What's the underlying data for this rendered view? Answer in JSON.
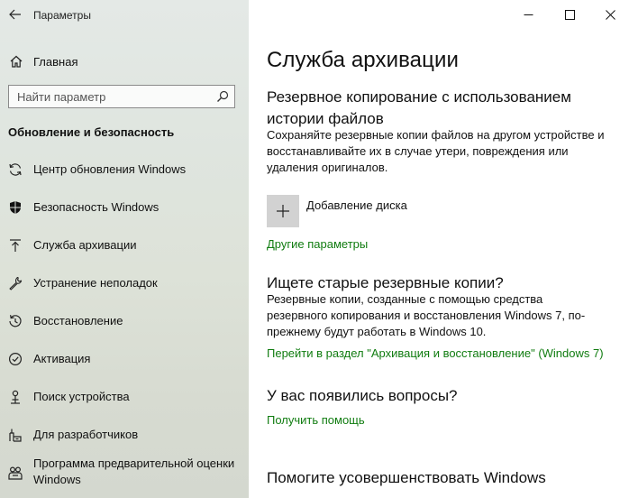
{
  "window": {
    "app_title": "Параметры"
  },
  "sidebar": {
    "home_label": "Главная",
    "search_placeholder": "Найти параметр",
    "section_title": "Обновление и безопасность",
    "items": [
      {
        "label": "Центр обновления Windows",
        "icon": "refresh-icon"
      },
      {
        "label": "Безопасность Windows",
        "icon": "shield-icon"
      },
      {
        "label": "Служба архивации",
        "icon": "backup-arrow-icon",
        "selected": true
      },
      {
        "label": "Устранение неполадок",
        "icon": "wrench-icon"
      },
      {
        "label": "Восстановление",
        "icon": "recovery-icon"
      },
      {
        "label": "Активация",
        "icon": "check-circle-icon"
      },
      {
        "label": "Поиск устройства",
        "icon": "person-locate-icon"
      },
      {
        "label": "Для разработчиков",
        "icon": "developer-icon"
      },
      {
        "label": "Программа предварительной оценки Windows",
        "label_line1": "Программа предварительной оценки",
        "label_line2": "Windows",
        "icon": "insider-icon"
      }
    ]
  },
  "main": {
    "title": "Служба архивации",
    "file_history": {
      "heading_line1": "Резервное копирование с использованием",
      "heading_line2": "истории файлов",
      "desc_line1": "Сохраняйте резервные копии файлов на другом устройстве и",
      "desc_line2": "восстанавливайте их в случае утери, повреждения или",
      "desc_line3": "удаления оригиналов.",
      "add_drive_label": "Добавление диска",
      "more_options_link": "Другие параметры"
    },
    "old_backups": {
      "heading": "Ищете старые резервные копии?",
      "desc_line1": "Резервные копии, созданные с помощью средства",
      "desc_line2": "резервного копирования и восстановления Windows 7, по-",
      "desc_line3": "прежнему будут работать в Windows 10.",
      "link": "Перейти в раздел \"Архивация и восстановление\" (Windows 7)"
    },
    "questions": {
      "heading": "У вас появились вопросы?",
      "link": "Получить помощь"
    },
    "improve": {
      "heading": "Помогите усовершенствовать Windows"
    }
  },
  "colors": {
    "link": "#107c10",
    "sidebar_bg": "#dfe5df",
    "tile": "#d2d2d2"
  }
}
